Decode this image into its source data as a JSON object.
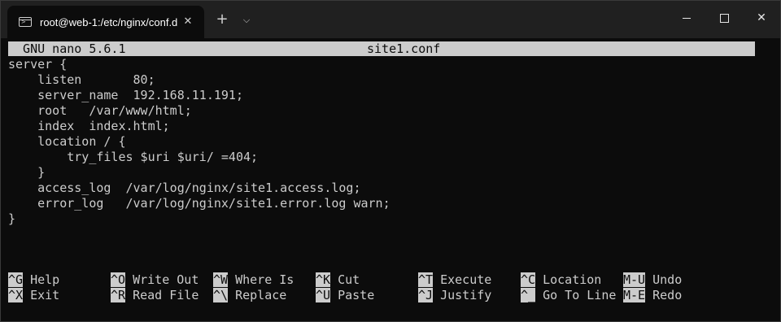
{
  "window": {
    "tab_title": "root@web-1:/etc/nginx/conf.d",
    "tab_close": "✕",
    "new_tab": "+",
    "dropdown": "⌵",
    "close": "✕"
  },
  "nano": {
    "version": "  GNU nano 5.6.1",
    "filename": "site1.conf"
  },
  "editor_lines": [
    "server {",
    "    listen       80;",
    "    server_name  192.168.11.191;",
    "    root   /var/www/html;",
    "    index  index.html;",
    "    location / {",
    "        try_files $uri $uri/ =404;",
    "    }",
    "    access_log  /var/log/nginx/site1.access.log;",
    "    error_log   /var/log/nginx/site1.error.log warn;",
    "}"
  ],
  "shortcuts": {
    "row1": [
      {
        "key": "^G",
        "label": "Help"
      },
      {
        "key": "^O",
        "label": "Write Out"
      },
      {
        "key": "^W",
        "label": "Where Is"
      },
      {
        "key": "^K",
        "label": "Cut"
      },
      {
        "key": "^T",
        "label": "Execute"
      },
      {
        "key": "^C",
        "label": "Location"
      },
      {
        "key": "M-U",
        "label": "Undo"
      }
    ],
    "row2": [
      {
        "key": "^X",
        "label": "Exit"
      },
      {
        "key": "^R",
        "label": "Read File"
      },
      {
        "key": "^\\",
        "label": "Replace"
      },
      {
        "key": "^U",
        "label": "Paste"
      },
      {
        "key": "^J",
        "label": "Justify"
      },
      {
        "key": "^_",
        "label": "Go To Line"
      },
      {
        "key": "M-E",
        "label": "Redo"
      }
    ]
  },
  "colors": {
    "background": "#0c0c0c",
    "foreground": "#cccccc",
    "titlebar": "#202020"
  }
}
